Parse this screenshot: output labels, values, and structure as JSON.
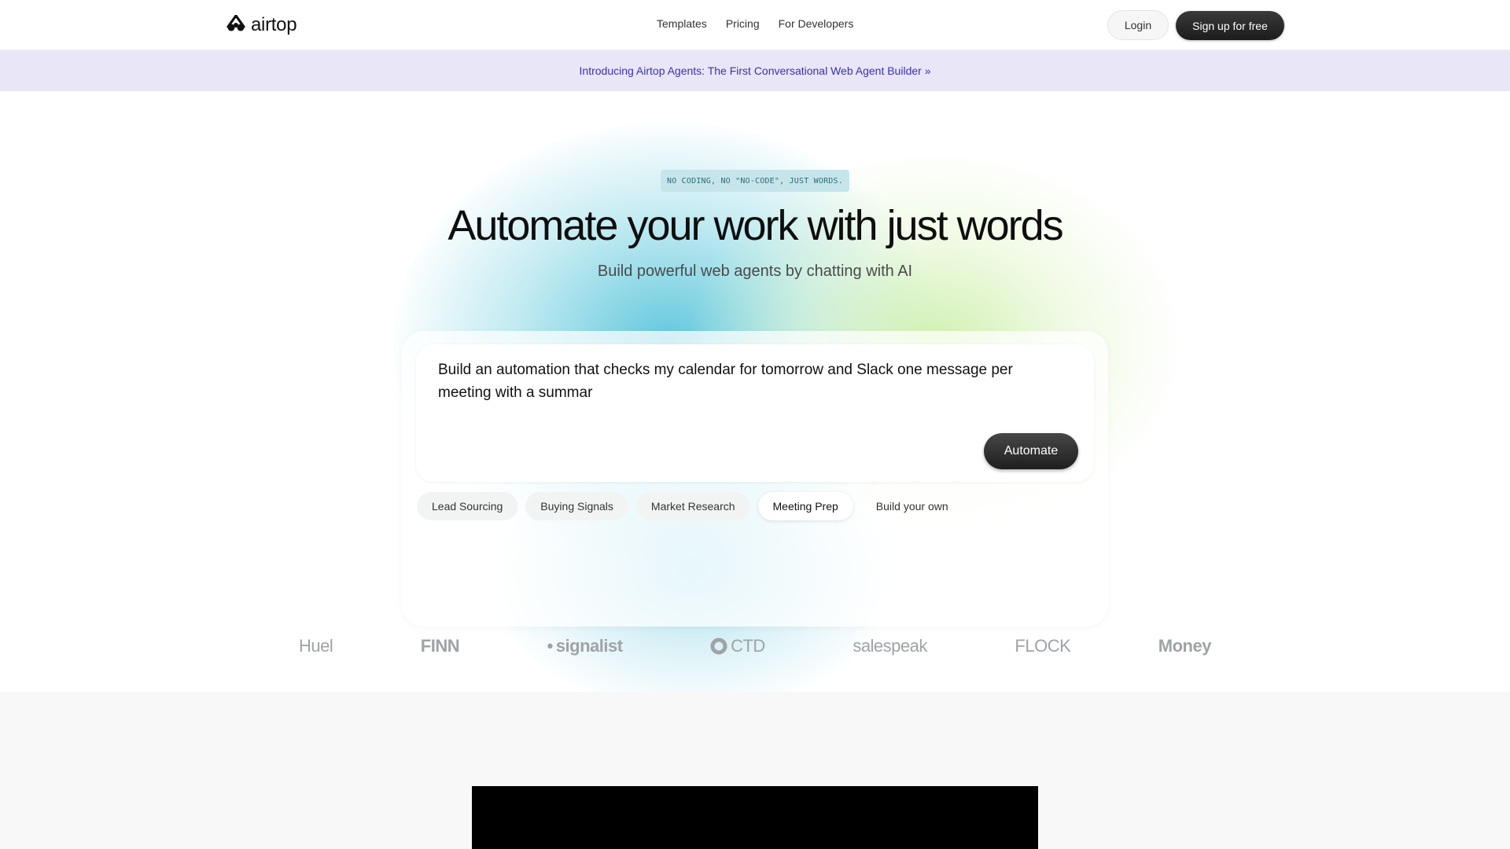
{
  "header": {
    "logo_text": "airtop",
    "nav": [
      "Templates",
      "Pricing",
      "For Developers"
    ],
    "login_label": "Login",
    "signup_label": "Sign up for free"
  },
  "banner": {
    "text": "Introducing Airtop Agents: The First Conversational Web Agent Builder »"
  },
  "hero": {
    "tag": "NO CODING, NO \"NO-CODE\", JUST WORDS.",
    "headline": "Automate your work with just words",
    "subheadline": "Build powerful web agents by chatting with AI",
    "prompt_text": "Build an automation that checks my calendar for tomorrow and Slack one message per meeting with a summar",
    "automate_label": "Automate",
    "chips": [
      "Lead Sourcing",
      "Buying Signals",
      "Market Research",
      "Meeting Prep",
      "Build your own"
    ],
    "active_chip": "Meeting Prep"
  },
  "logos": [
    "Huel",
    "FINN",
    "signalist",
    "CTD",
    "salespeak",
    "FLOCK",
    "Money"
  ],
  "colors": {
    "banner_bg": "#e9e6f8",
    "banner_text": "#3b2fb5",
    "tag_bg": "#c6e5ea",
    "button_dark": "#1e1e1e"
  }
}
